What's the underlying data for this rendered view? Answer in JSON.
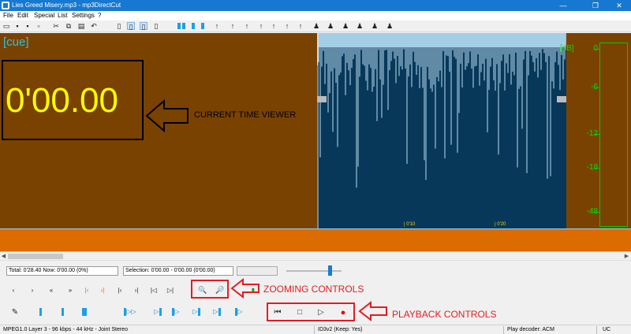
{
  "window": {
    "title": "Lies Greed Misery.mp3 - mp3DirectCut",
    "minimize": "—",
    "maximize": "❐",
    "close": "✕"
  },
  "menu": [
    "File",
    "Edit",
    "Special",
    "List",
    "Settings",
    "?"
  ],
  "cue_panel": {
    "cue_label": "[cue]",
    "time_value": "0'00.00",
    "annotation": "CURRENT TIME VIEWER"
  },
  "waveform": {
    "ruler_labels": [
      "| 0'10",
      "| 0'20"
    ]
  },
  "meter": {
    "unit": "[dB]",
    "ticks": [
      "0",
      "-6",
      "-12",
      "-18",
      "-48"
    ]
  },
  "info": {
    "total": "Total:  0'28.40    Now:  0'00.00    (0%)",
    "selection": "Selection:  0'00.00 - 0'00.00  (0'00.00)"
  },
  "controls": {
    "zoom_annotation": "ZOOMING CONTROLS",
    "playback_annotation": "PLAYBACK CONTROLS",
    "zoom_in_glyph": "🔍",
    "zoom_out_glyph": "🔎",
    "prev_glyph": "⏮",
    "stop_glyph": "□",
    "play_glyph": "▷",
    "record_glyph": "●"
  },
  "status": {
    "format": "MPEG1.0 Layer 3 - 96 kbps - 44 kHz - Joint Stereo",
    "id3": "ID3v2  (Keep: Yes)",
    "decoder": "Play decoder: ACM",
    "mode": "UC"
  },
  "colors": {
    "cue_bg": "#7a4200",
    "wave_bg": "#07385a",
    "overview_bg": "#dd6c00",
    "time_color": "#ffff00",
    "db_color": "#00e000",
    "annotation_red": "#e21d22"
  }
}
